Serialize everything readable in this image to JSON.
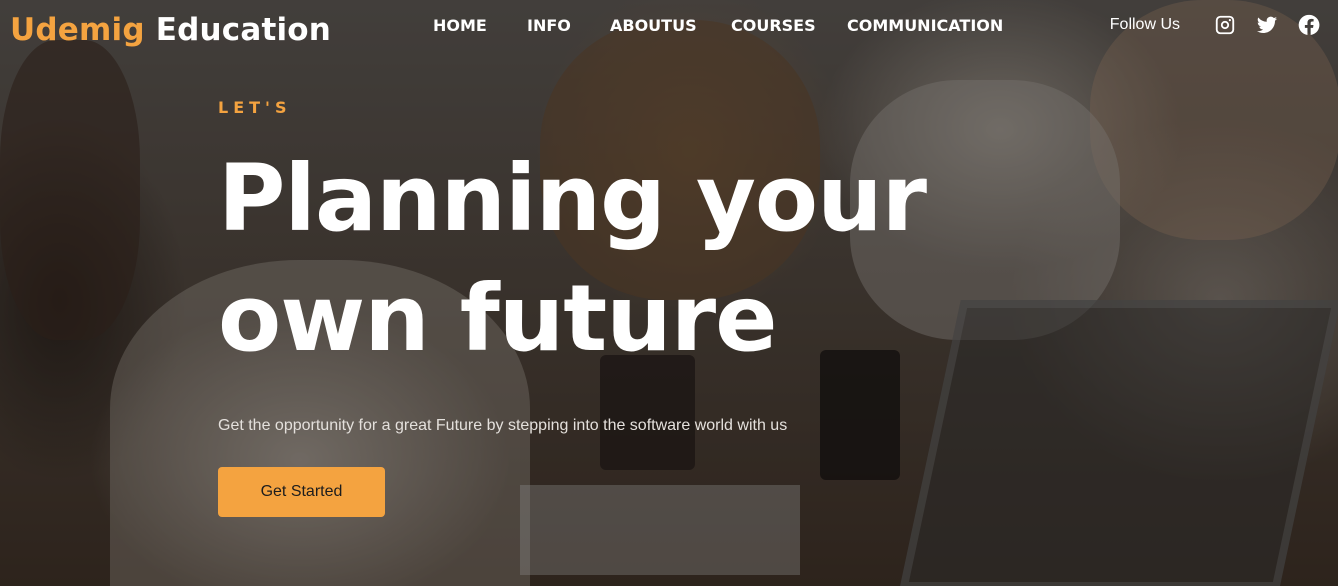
{
  "brand": {
    "part1": "Udemig",
    "part2": "Education"
  },
  "nav": {
    "items": [
      {
        "label": "HOME"
      },
      {
        "label": "INFO"
      },
      {
        "label": "ABOUTUS"
      },
      {
        "label": "COURSES"
      },
      {
        "label": "COMMUNICATION"
      }
    ]
  },
  "social": {
    "follow_label": "Follow Us",
    "icons": [
      "instagram-icon",
      "twitter-icon",
      "facebook-icon"
    ]
  },
  "hero": {
    "kicker": "LET'S",
    "headline_line1": "Planning your",
    "headline_line2": "own future",
    "subtitle": "Get the opportunity for a great Future by stepping into the software world with us",
    "cta_label": "Get Started"
  },
  "colors": {
    "accent": "#f4a340",
    "text": "#ffffff"
  }
}
